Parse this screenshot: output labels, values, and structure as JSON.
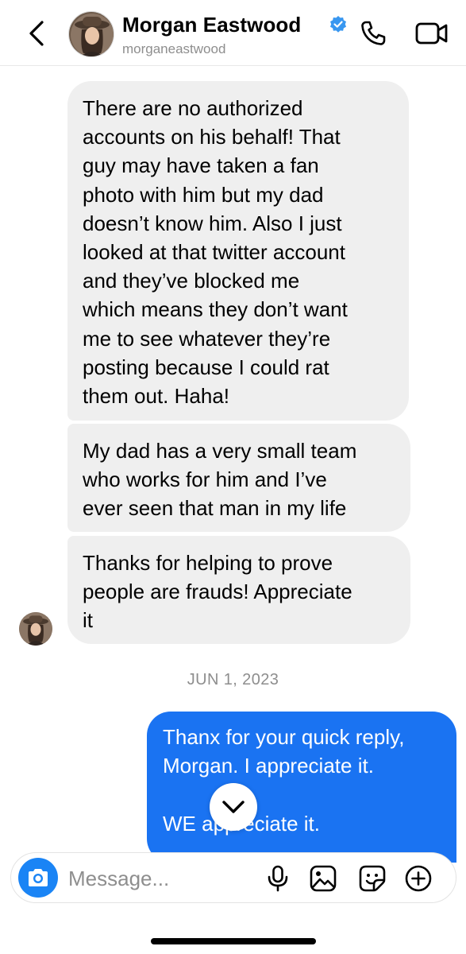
{
  "header": {
    "back_icon": "chevron-left-icon",
    "name": "Morgan Eastwood",
    "username": "morganeastwood",
    "verified_color": "#3897f0",
    "call_icon": "phone-icon",
    "video_icon": "video-camera-icon"
  },
  "messages": [
    {
      "direction": "incoming",
      "text": "There are no authorized\naccounts on his behalf! That\nguy may have taken a fan\nphoto with him but my dad\ndoesn’t know him. Also I just\nlooked at that twitter account\nand they’ve blocked me\nwhich means they don’t want\nme to see whatever they’re\nposting because I could rat\nthem out. Haha!"
    },
    {
      "direction": "incoming",
      "text": "My dad has a very small team\nwho works for him and I’ve\never seen that man in my life"
    },
    {
      "direction": "incoming",
      "text": "Thanks for helping to prove\npeople are frauds! Appreciate\nit"
    }
  ],
  "date_separator": "JUN 1, 2023",
  "outgoing_message": {
    "direction": "outgoing",
    "text": "Thanx for your quick reply,\nMorgan. I appreciate it.\n\nWE appreciate it."
  },
  "scroll_button_icon": "chevron-down-icon",
  "composer": {
    "placeholder": "Message...",
    "camera_icon": "camera-icon",
    "mic_icon": "microphone-icon",
    "gallery_icon": "image-icon",
    "sticker_icon": "sticker-icon",
    "plus_icon": "plus-circle-icon"
  },
  "colors": {
    "incoming_bubble": "#efefef",
    "outgoing_bubble": "#1a73f2",
    "camera_button": "#1a84f5",
    "secondary_text": "#8e8e8e"
  }
}
